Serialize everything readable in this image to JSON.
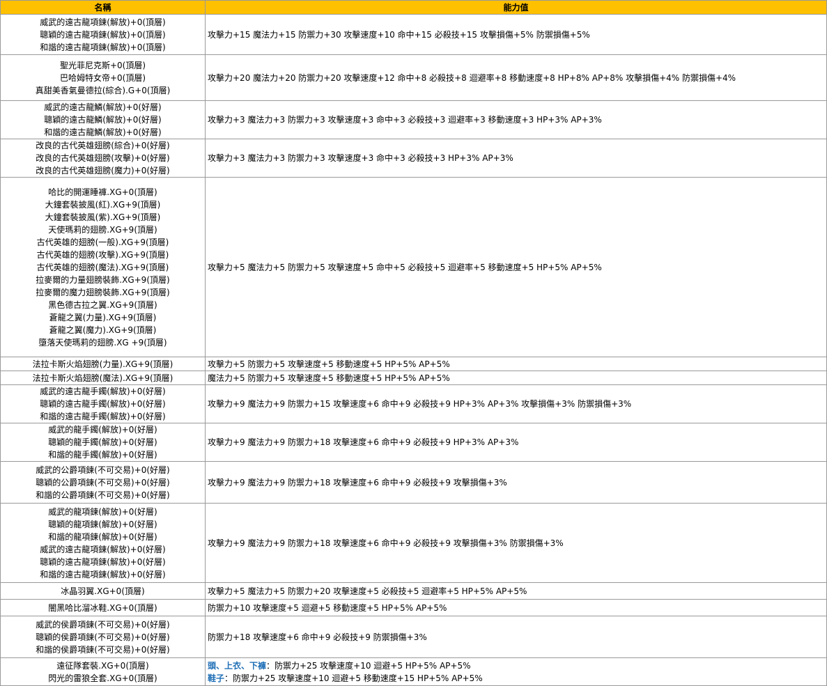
{
  "header": {
    "name": "名稱",
    "stats": "能力值"
  },
  "rows": [
    {
      "height": 58,
      "names": [
        "威武的遠古龍項鍊(解放)+0(頂層)",
        "聰穎的遠古龍項鍊(解放)+0(頂層)",
        "和諧的遠古龍項鍊(解放)+0(頂層)"
      ],
      "stats": "攻擊力+15 魔法力+15 防禦力+30 攻擊速度+10 命中+15 必殺技+15 攻擊損傷+5% 防禦損傷+5%"
    },
    {
      "height": 66,
      "names": [
        "聖光菲尼克斯+0(頂層)",
        "巴哈姆特女帝+0(頂層)",
        "真甜美香氣曼德拉(綜合).G+0(頂層)"
      ],
      "stats": "攻擊力+20 魔法力+20 防禦力+20 攻擊速度+12 命中+8 必殺技+8 迴避率+8 移動速度+8 HP+8% AP+8% 攻擊損傷+4% 防禦損傷+4%"
    },
    {
      "height": 53,
      "names": [
        "威武的遠古龍鱗(解放)+0(好層)",
        "聰穎的遠古龍鱗(解放)+0(好層)",
        "和諧的遠古龍鱗(解放)+0(好層)"
      ],
      "stats": "攻擊力+3 魔法力+3 防禦力+3 攻擊速度+3 命中+3 必殺技+3 迴避率+3 移動速度+3  HP+3% AP+3%"
    },
    {
      "height": 55,
      "names": [
        "改良的古代英雄翅膀(綜合)+0(好層)",
        "改良的古代英雄翅膀(攻擊)+0(好層)",
        "改良的古代英雄翅膀(魔力)+0(好層)"
      ],
      "stats": "攻擊力+3 魔法力+3 防禦力+3 攻擊速度+3 命中+3 必殺技+3 HP+3% AP+3%"
    },
    {
      "height": 258,
      "names": [
        "哈比的開運睡褲.XG+0(頂層)",
        "大鐘套裝披風(紅).XG+9(頂層)",
        "大鐘套裝披風(紫).XG+9(頂層)",
        "天使瑪莉的翅膀.XG+9(頂層)",
        "古代英雄的翅膀(一般).XG+9(頂層)",
        "古代英雄的翅膀(攻擊).XG+9(頂層)",
        "古代英雄的翅膀(魔法).XG+9(頂層)",
        "拉麥爾的力量翅膀裝飾.XG+9(頂層)",
        "拉麥爾的魔力翅膀裝飾.XG+9(頂層)",
        "黑色德古拉之翼.XG+9(頂層)",
        "蒼龍之翼(力量).XG+9(頂層)",
        "蒼龍之翼(魔力).XG+9(頂層)",
        "墮落天使瑪莉的翅膀.XG +9(頂層)"
      ],
      "stats": "攻擊力+5 魔法力+5 防禦力+5 攻擊速度+5 命中+5 必殺技+5 迴避率+5 移動速度+5  HP+5% AP+5%"
    },
    {
      "height": 20,
      "names": [
        "法拉卡斯火焰翅膀(力量).XG+9(頂層)"
      ],
      "stats": "攻擊力+5 防禦力+5 攻擊速度+5 移動速度+5 HP+5% AP+5%"
    },
    {
      "height": 20,
      "names": [
        "法拉卡斯火焰翅膀(魔法).XG+9(頂層)"
      ],
      "stats": "魔法力+5 防禦力+5 攻擊速度+5 移動速度+5 HP+5% AP+5%"
    },
    {
      "height": 54,
      "names": [
        "威武的遠古龍手鐲(解放)+0(好層)",
        "聰穎的遠古龍手鐲(解放)+0(好層)",
        "和諧的遠古龍手鐲(解放)+0(好層)"
      ],
      "stats": "攻擊力+9 魔法力+9 防禦力+15 攻擊速度+6 命中+9 必殺技+9  HP+3% AP+3% 攻擊損傷+3% 防禦損傷+3%"
    },
    {
      "height": 54,
      "names": [
        "威武的龍手鐲(解放)+0(好層)",
        "聰穎的龍手鐲(解放)+0(好層)",
        "和諧的龍手鐲(解放)+0(好層)"
      ],
      "stats": "攻擊力+9 魔法力+9 防禦力+18 攻擊速度+6 命中+9 必殺技+9  HP+3% AP+3%"
    },
    {
      "height": 60,
      "names": [
        "威武的公爵項鍊(不可交易)+0(好層)",
        "聰穎的公爵項鍊(不可交易)+0(好層)",
        "和諧的公爵項鍊(不可交易)+0(好層)"
      ],
      "stats": "攻擊力+9 魔法力+9 防禦力+18 攻擊速度+6 命中+9 必殺技+9 攻擊損傷+3%"
    },
    {
      "height": 114,
      "names": [
        "威武的龍項鍊(解放)+0(好層)",
        "聰穎的龍項鍊(解放)+0(好層)",
        "和諧的龍項鍊(解放)+0(好層)",
        "威武的遠古龍項鍊(解放)+0(好層)",
        "聰穎的遠古龍項鍊(解放)+0(好層)",
        "和諧的遠古龍項鍊(解放)+0(好層)"
      ],
      "stats": "攻擊力+9 魔法力+9 防禦力+18 攻擊速度+6 命中+9 必殺技+9 攻擊損傷+3% 防禦損傷+3%"
    },
    {
      "height": 24,
      "names": [
        "冰晶羽翼.XG+0(頂層)"
      ],
      "stats": "攻擊力+5 魔法力+5 防禦力+20 攻擊速度+5 必殺技+5 迴避率+5 HP+5% AP+5%"
    },
    {
      "height": 24,
      "names": [
        "闇黑哈比溜冰鞋.XG+0(頂層)"
      ],
      "stats": "防禦力+10 攻擊速度+5 迴避+5 移動速度+5 HP+5% AP+5%"
    },
    {
      "height": 60,
      "names": [
        "威武的侯爵項鍊(不可交易)+0(好層)",
        "聰穎的侯爵項鍊(不可交易)+0(好層)",
        "和諧的侯爵項鍊(不可交易)+0(好層)"
      ],
      "stats": "防禦力+18 攻擊速度+6 命中+9 必殺技+9  防禦損傷+3%"
    },
    {
      "height": 40,
      "names": [
        "遠征隊套裝.XG+0(頂層)",
        "閃光的雷狼全套.XG+0(頂層)"
      ],
      "stat_lines": [
        {
          "prefix": "頭、上衣、下褲",
          "text": "：防禦力+25 攻擊速度+10 迴避+5 HP+5% AP+5%"
        },
        {
          "prefix": "鞋子",
          "text": "：防禦力+25 攻擊速度+10 迴避+5 移動速度+15 HP+5% AP+5%"
        }
      ]
    }
  ]
}
